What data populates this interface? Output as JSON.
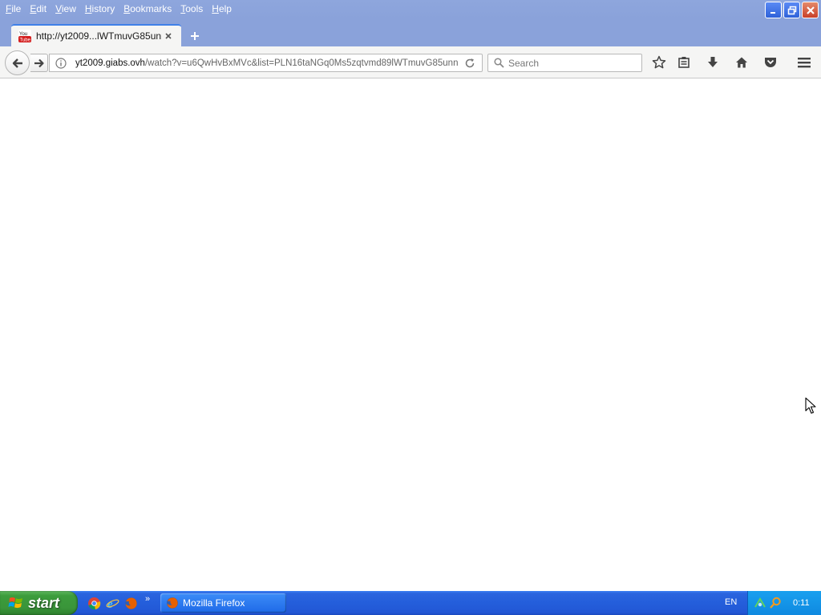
{
  "menu": [
    "File",
    "Edit",
    "View",
    "History",
    "Bookmarks",
    "Tools",
    "Help"
  ],
  "tab": {
    "title": "http://yt2009...lWTmuvG85unn"
  },
  "urlbar": {
    "url_host": "yt2009.giabs.ovh",
    "url_path": "/watch?v=u6QwHvBxMVc&list=PLN16taNGq0Ms5zqtvmd89lWTmuvG85unn"
  },
  "search": {
    "placeholder": "Search"
  },
  "taskbar": {
    "start_label": "start",
    "window_label": "Mozilla Firefox",
    "language": "EN",
    "clock": "0:11",
    "more": "»"
  },
  "colors": {
    "titlebar": "#8aa2da",
    "toolbar": "#f5f5f4",
    "taskbar": "#245edb",
    "start": "#3c9c3c",
    "tray": "#0f89e0",
    "tab_accent": "#3f80e8"
  }
}
